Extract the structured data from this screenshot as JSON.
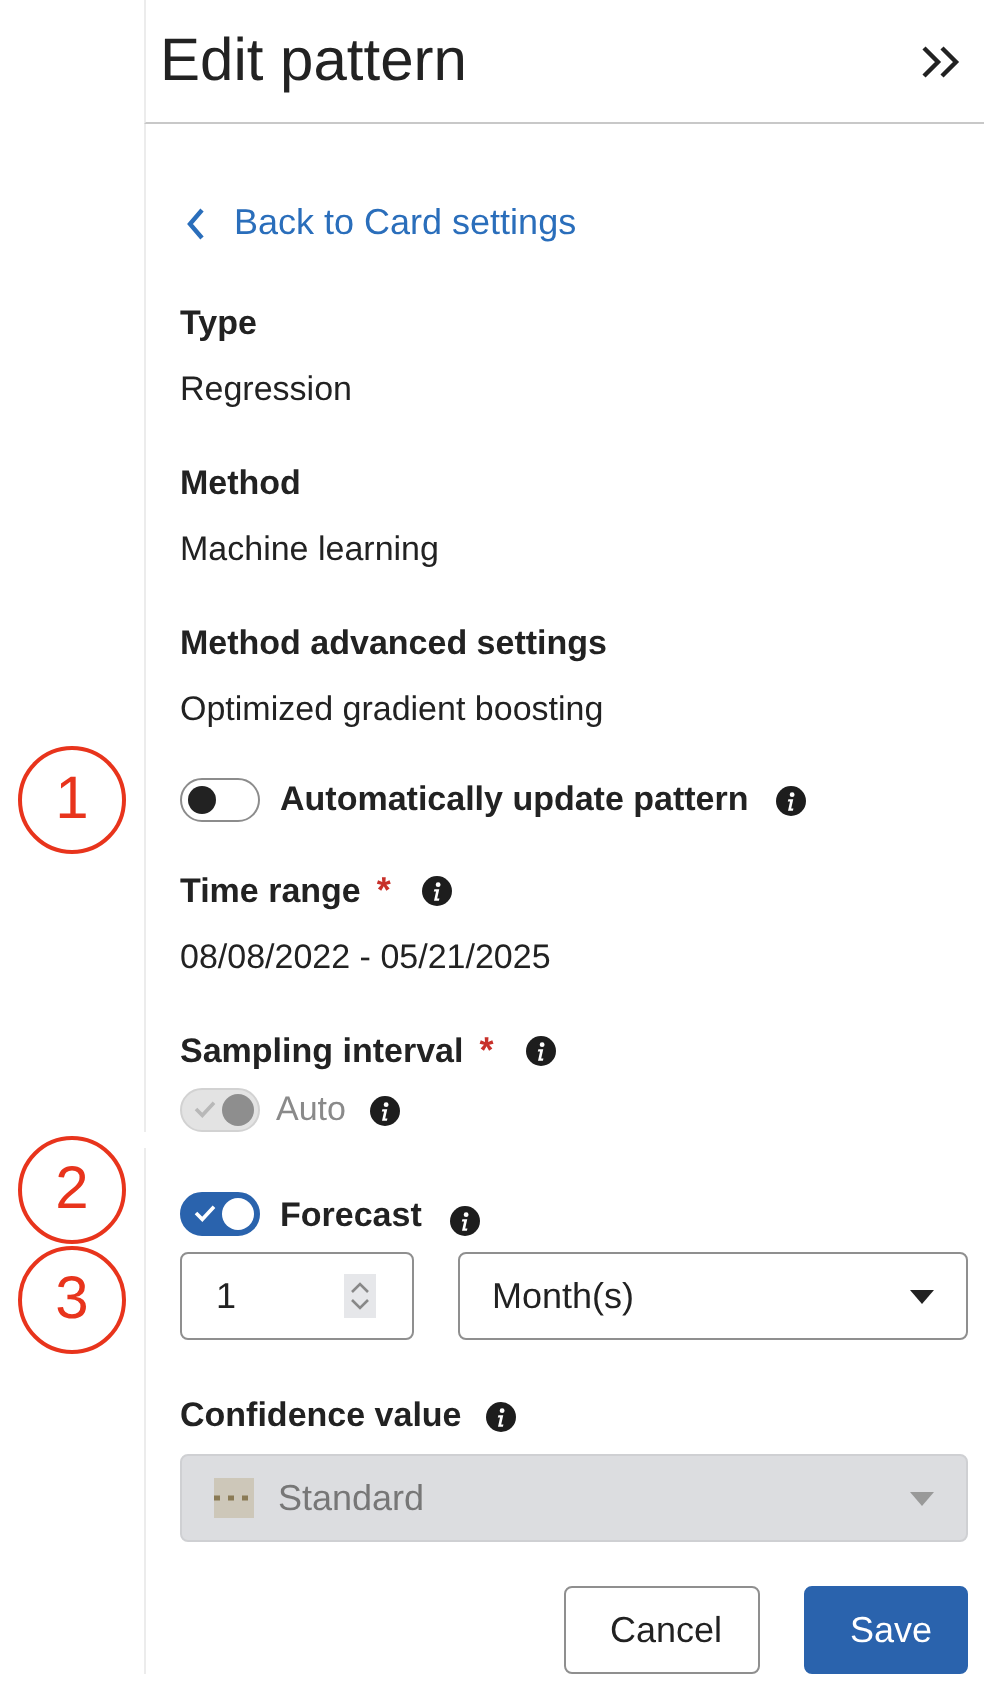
{
  "header": {
    "title": "Edit pattern"
  },
  "back_link": "Back to Card settings",
  "fields": [
    {
      "label": "Type",
      "value": "Regression"
    },
    {
      "label": "Method",
      "value": "Machine learning"
    },
    {
      "label": "Method advanced settings",
      "value": "Optimized gradient boosting"
    }
  ],
  "auto_update": {
    "label": "Automatically update pattern",
    "on": false,
    "info": true,
    "marker": "1"
  },
  "time_range": {
    "label": "Time range",
    "required_mark": "*",
    "info": true,
    "value": "08/08/2022 - 05/21/2025"
  },
  "sampling_interval": {
    "label": "Sampling interval",
    "required_mark": "*",
    "info": true,
    "auto": {
      "label": "Auto",
      "on": true,
      "disabled": true,
      "info": true
    }
  },
  "forecast": {
    "label": "Forecast",
    "on": true,
    "info": true,
    "marker": "2",
    "count": {
      "value": "1",
      "marker": "3"
    },
    "unit": {
      "value": "Month(s)"
    }
  },
  "confidence": {
    "label": "Confidence value",
    "info": true,
    "value": "Standard",
    "disabled": true
  },
  "buttons": [
    {
      "label": "Cancel",
      "kind": "secondary"
    },
    {
      "label": "Save",
      "kind": "primary"
    }
  ]
}
